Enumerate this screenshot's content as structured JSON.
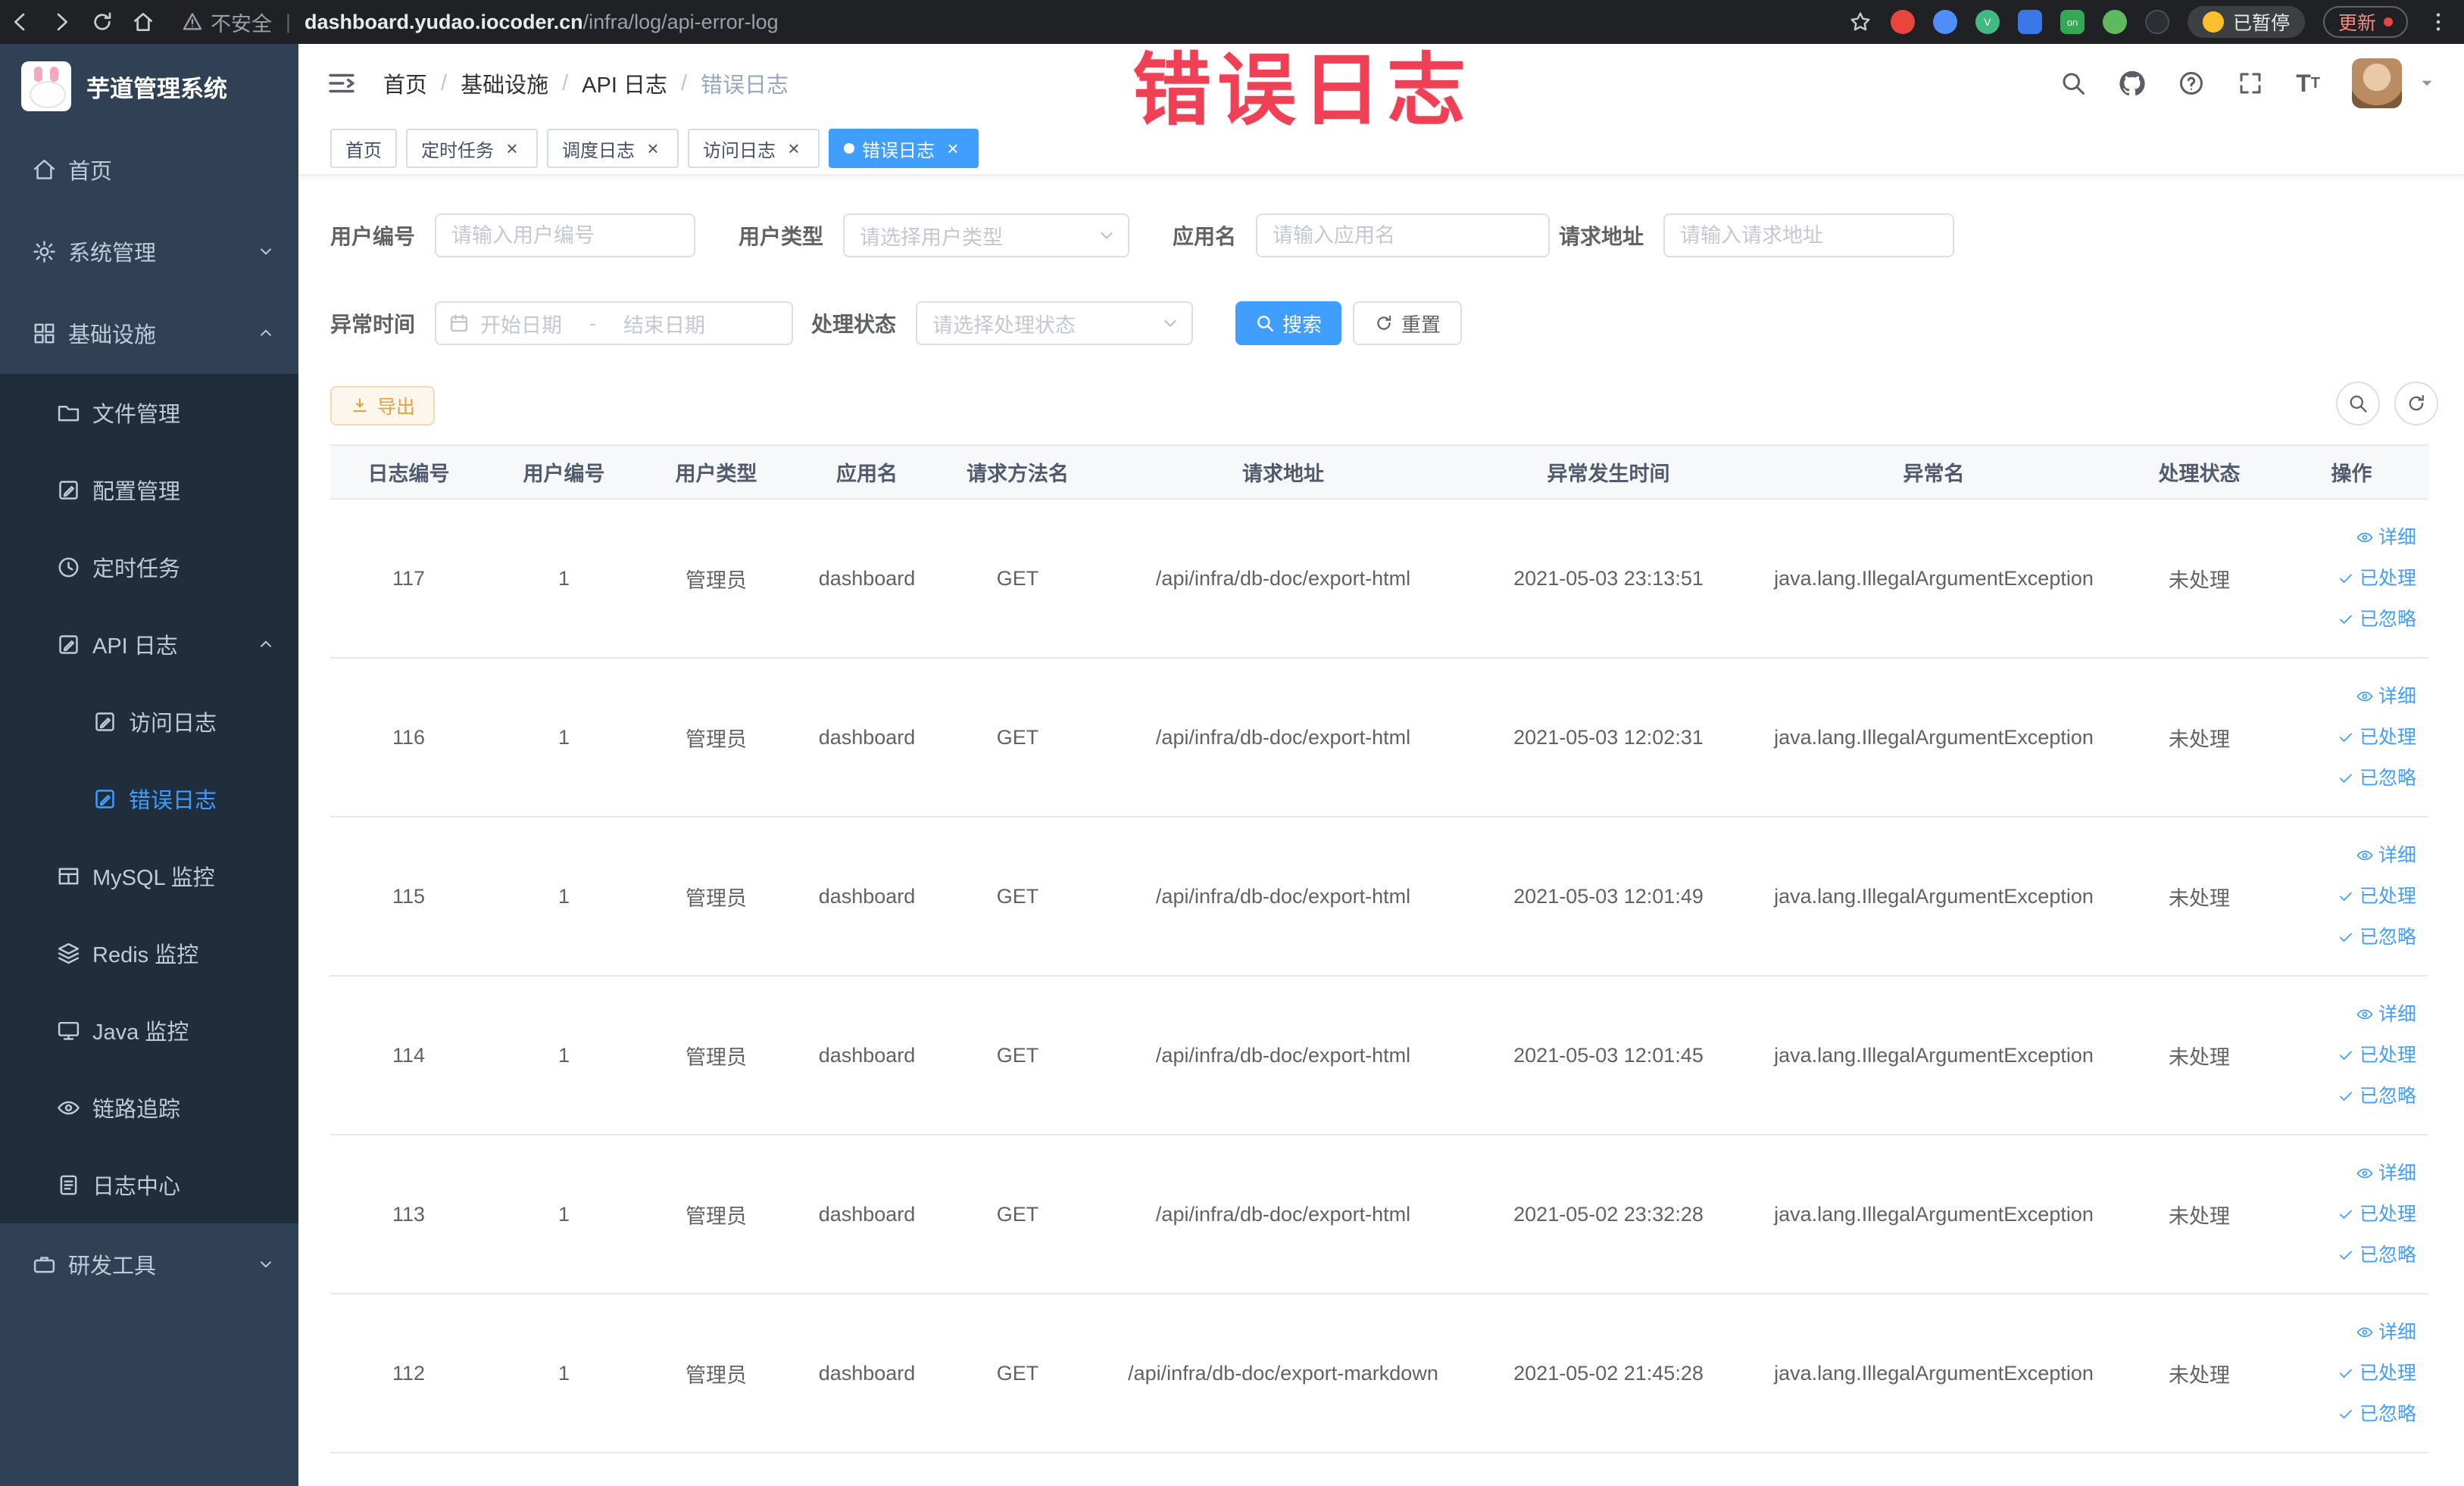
{
  "browser": {
    "security_label": "不安全",
    "url_host": "dashboard.yudao.iocoder.cn",
    "url_path": "/infra/log/api-error-log",
    "paused_button": "已暂停",
    "update_button": "更新"
  },
  "annotation": {
    "text": "错误日志",
    "color": "#ef4056"
  },
  "sidebar": {
    "logo_title": "芋道管理系统",
    "items": [
      {
        "key": "home",
        "label": "首页",
        "icon": "home",
        "level": 0
      },
      {
        "key": "system",
        "label": "系统管理",
        "icon": "gear",
        "level": 0,
        "arrow": "down"
      },
      {
        "key": "infra",
        "label": "基础设施",
        "icon": "grid",
        "level": 0,
        "arrow": "up"
      },
      {
        "key": "file",
        "label": "文件管理",
        "icon": "folder",
        "level": 1
      },
      {
        "key": "config",
        "label": "配置管理",
        "icon": "docpen",
        "level": 1
      },
      {
        "key": "job",
        "label": "定时任务",
        "icon": "clock",
        "level": 1
      },
      {
        "key": "api-log",
        "label": "API 日志",
        "icon": "docpen",
        "level": 1,
        "arrow": "up"
      },
      {
        "key": "access-log",
        "label": "访问日志",
        "icon": "docpen",
        "level": 2
      },
      {
        "key": "error-log",
        "label": "错误日志",
        "icon": "docpen",
        "level": 2,
        "active": true
      },
      {
        "key": "mysql",
        "label": "MySQL 监控",
        "icon": "table",
        "level": 1
      },
      {
        "key": "redis",
        "label": "Redis 监控",
        "icon": "layers",
        "level": 1
      },
      {
        "key": "java",
        "label": "Java 监控",
        "icon": "monitor",
        "level": 1
      },
      {
        "key": "trace",
        "label": "链路追踪",
        "icon": "eye",
        "level": 1
      },
      {
        "key": "log-center",
        "label": "日志中心",
        "icon": "doc",
        "level": 1
      },
      {
        "key": "dev-tools",
        "label": "研发工具",
        "icon": "briefcase",
        "level": 0,
        "arrow": "down"
      }
    ]
  },
  "header": {
    "breadcrumb": [
      "首页",
      "基础设施",
      "API 日志",
      "错误日志"
    ]
  },
  "tabs": [
    {
      "label": "首页",
      "closable": false,
      "active": false
    },
    {
      "label": "定时任务",
      "closable": true,
      "active": false
    },
    {
      "label": "调度日志",
      "closable": true,
      "active": false
    },
    {
      "label": "访问日志",
      "closable": true,
      "active": false
    },
    {
      "label": "错误日志",
      "closable": true,
      "active": true
    }
  ],
  "filters": {
    "user_id": {
      "label": "用户编号",
      "placeholder": "请输入用户编号"
    },
    "user_type": {
      "label": "用户类型",
      "placeholder": "请选择用户类型"
    },
    "app_name": {
      "label": "应用名",
      "placeholder": "请输入应用名"
    },
    "request_url": {
      "label": "请求地址",
      "placeholder": "请输入请求地址"
    },
    "exception_time": {
      "label": "异常时间",
      "start_placeholder": "开始日期",
      "separator": "-",
      "end_placeholder": "结束日期"
    },
    "process_status": {
      "label": "处理状态",
      "placeholder": "请选择处理状态"
    },
    "search_button": "搜索",
    "reset_button": "重置"
  },
  "toolbar": {
    "export_button": "导出"
  },
  "table": {
    "columns": [
      "日志编号",
      "用户编号",
      "用户类型",
      "应用名",
      "请求方法名",
      "请求地址",
      "异常发生时间",
      "异常名",
      "处理状态",
      "操作"
    ],
    "actions": [
      "详细",
      "已处理",
      "已忽略"
    ],
    "rows": [
      {
        "id": "117",
        "user_id": "1",
        "user_type": "管理员",
        "app": "dashboard",
        "method": "GET",
        "url": "/api/infra/db-doc/export-html",
        "time": "2021-05-03 23:13:51",
        "exception": "java.lang.IllegalArgumentException",
        "status": "未处理"
      },
      {
        "id": "116",
        "user_id": "1",
        "user_type": "管理员",
        "app": "dashboard",
        "method": "GET",
        "url": "/api/infra/db-doc/export-html",
        "time": "2021-05-03 12:02:31",
        "exception": "java.lang.IllegalArgumentException",
        "status": "未处理"
      },
      {
        "id": "115",
        "user_id": "1",
        "user_type": "管理员",
        "app": "dashboard",
        "method": "GET",
        "url": "/api/infra/db-doc/export-html",
        "time": "2021-05-03 12:01:49",
        "exception": "java.lang.IllegalArgumentException",
        "status": "未处理"
      },
      {
        "id": "114",
        "user_id": "1",
        "user_type": "管理员",
        "app": "dashboard",
        "method": "GET",
        "url": "/api/infra/db-doc/export-html",
        "time": "2021-05-03 12:01:45",
        "exception": "java.lang.IllegalArgumentException",
        "status": "未处理"
      },
      {
        "id": "113",
        "user_id": "1",
        "user_type": "管理员",
        "app": "dashboard",
        "method": "GET",
        "url": "/api/infra/db-doc/export-html",
        "time": "2021-05-02 23:32:28",
        "exception": "java.lang.IllegalArgumentException",
        "status": "未处理"
      },
      {
        "id": "112",
        "user_id": "1",
        "user_type": "管理员",
        "app": "dashboard",
        "method": "GET",
        "url": "/api/infra/db-doc/export-markdown",
        "time": "2021-05-02 21:45:28",
        "exception": "java.lang.IllegalArgumentException",
        "status": "未处理"
      }
    ]
  },
  "colors": {
    "accent": "#409eff",
    "sidebar_bg": "#304156",
    "submenu_bg": "#1f2d3d",
    "warning": "#e6a23c"
  }
}
